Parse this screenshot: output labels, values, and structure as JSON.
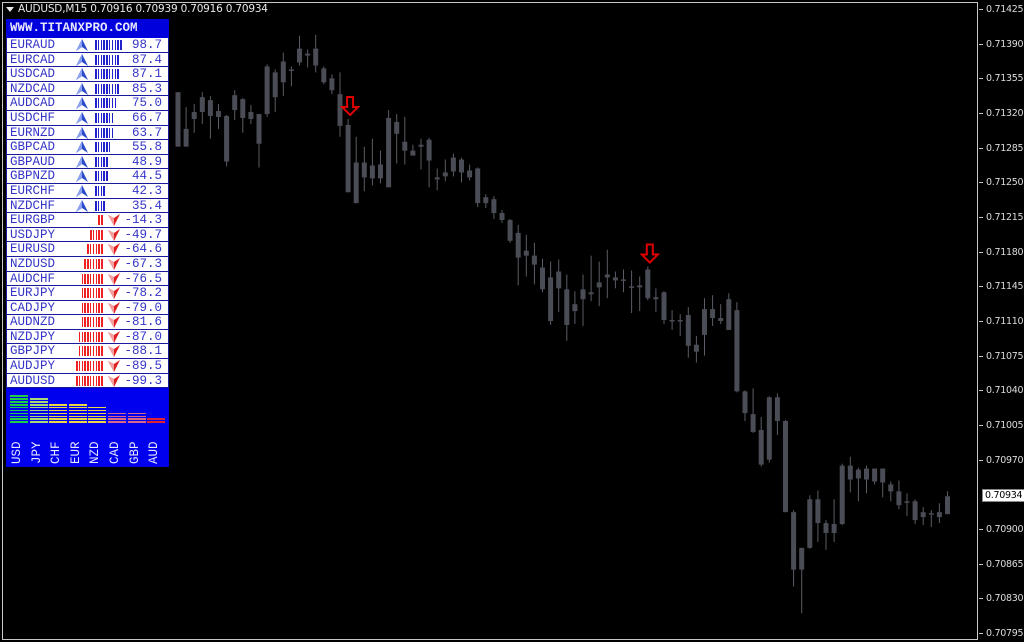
{
  "window": {
    "symbol": "AUDUSD",
    "timeframe": "M15",
    "title": "AUDUSD,M15  0.70916 0.70939 0.70916 0.70934",
    "ohlc": {
      "open": "0.70916",
      "high": "0.70939",
      "low": "0.70916",
      "close": "0.70934"
    }
  },
  "price_axis": {
    "ticks": [
      "0.71425",
      "0.71390",
      "0.71355",
      "0.71320",
      "0.71285",
      "0.71250",
      "0.71215",
      "0.71180",
      "0.71145",
      "0.71110",
      "0.71075",
      "0.71040",
      "0.71005",
      "0.70970",
      "0.70900",
      "0.70865",
      "0.70830",
      "0.70795"
    ],
    "current_price": "0.70934",
    "max": 0.71425,
    "min": 0.70795
  },
  "colors": {
    "candle": "#4a4d55",
    "candle_wick": "#5a5d65",
    "signal_arrow": "#e00000",
    "panel_blue": "#0000ee",
    "text_blue": "#3434c8",
    "bar_blue": "#2222cc",
    "bar_red": "#ee2222",
    "up_arrow": "#2a4ac8",
    "down_arrow": "#e02020"
  },
  "panel": {
    "header": "WWW.TITANXPRO.COM",
    "pairs": [
      {
        "pair": "EURAUD",
        "dir": "up",
        "bars": 10,
        "value": "98.7"
      },
      {
        "pair": "EURCAD",
        "dir": "up",
        "bars": 9,
        "value": "87.4"
      },
      {
        "pair": "USDCAD",
        "dir": "up",
        "bars": 9,
        "value": "87.1"
      },
      {
        "pair": "NZDCAD",
        "dir": "up",
        "bars": 9,
        "value": "85.3"
      },
      {
        "pair": "AUDCAD",
        "dir": "up",
        "bars": 8,
        "value": "75.0"
      },
      {
        "pair": "USDCHF",
        "dir": "up",
        "bars": 7,
        "value": "66.7"
      },
      {
        "pair": "EURNZD",
        "dir": "up",
        "bars": 7,
        "value": "63.7"
      },
      {
        "pair": "GBPCAD",
        "dir": "up",
        "bars": 6,
        "value": "55.8"
      },
      {
        "pair": "GBPAUD",
        "dir": "up",
        "bars": 5,
        "value": "48.9"
      },
      {
        "pair": "GBPNZD",
        "dir": "up",
        "bars": 5,
        "value": "44.5"
      },
      {
        "pair": "EURCHF",
        "dir": "up",
        "bars": 4,
        "value": "42.3"
      },
      {
        "pair": "NZDCHF",
        "dir": "up",
        "bars": 4,
        "value": "35.4"
      },
      {
        "pair": "EURGBP",
        "dir": "down",
        "bars": 2,
        "value": "-14.3"
      },
      {
        "pair": "USDJPY",
        "dir": "down",
        "bars": 5,
        "value": "-49.7"
      },
      {
        "pair": "EURUSD",
        "dir": "down",
        "bars": 6,
        "value": "-64.6"
      },
      {
        "pair": "NZDUSD",
        "dir": "down",
        "bars": 7,
        "value": "-67.3"
      },
      {
        "pair": "AUDCHF",
        "dir": "down",
        "bars": 8,
        "value": "-76.5"
      },
      {
        "pair": "EURJPY",
        "dir": "down",
        "bars": 8,
        "value": "-78.2"
      },
      {
        "pair": "CADJPY",
        "dir": "down",
        "bars": 8,
        "value": "-79.0"
      },
      {
        "pair": "AUDNZD",
        "dir": "down",
        "bars": 8,
        "value": "-81.6"
      },
      {
        "pair": "NZDJPY",
        "dir": "down",
        "bars": 9,
        "value": "-87.0"
      },
      {
        "pair": "GBPJPY",
        "dir": "down",
        "bars": 9,
        "value": "-88.1"
      },
      {
        "pair": "AUDJPY",
        "dir": "down",
        "bars": 10,
        "value": "-89.5"
      },
      {
        "pair": "AUDUSD",
        "dir": "down",
        "bars": 10,
        "value": "-99.3"
      }
    ],
    "currencies": [
      {
        "name": "USD",
        "level": 10,
        "color": "#22cc44"
      },
      {
        "name": "JPY",
        "level": 9,
        "color": "#a8d878"
      },
      {
        "name": "CHF",
        "level": 7,
        "color": "#e8d848"
      },
      {
        "name": "EUR",
        "level": 7,
        "color": "#e8d848"
      },
      {
        "name": "NZD",
        "level": 6,
        "color": "#e8d848"
      },
      {
        "name": "CAD",
        "level": 4,
        "color": "#d86888"
      },
      {
        "name": "GBP",
        "level": 4,
        "color": "#d86888"
      },
      {
        "name": "AUD",
        "level": 2,
        "color": "#dd2233"
      }
    ]
  },
  "chart_data": {
    "type": "candlestick",
    "symbol": "AUDUSD",
    "timeframe": "M15",
    "ylim": [
      0.70795,
      0.71425
    ],
    "candles": [
      {
        "o": 0.71342,
        "h": 0.71342,
        "l": 0.71287,
        "c": 0.71287
      },
      {
        "o": 0.71305,
        "h": 0.71327,
        "l": 0.71289,
        "c": 0.71287
      },
      {
        "o": 0.71315,
        "h": 0.7133,
        "l": 0.71301,
        "c": 0.71322
      },
      {
        "o": 0.71337,
        "h": 0.71342,
        "l": 0.7131,
        "c": 0.71322
      },
      {
        "o": 0.71334,
        "h": 0.71338,
        "l": 0.71295,
        "c": 0.71318
      },
      {
        "o": 0.71323,
        "h": 0.7133,
        "l": 0.71305,
        "c": 0.71317
      },
      {
        "o": 0.71318,
        "h": 0.71319,
        "l": 0.71267,
        "c": 0.71272
      },
      {
        "o": 0.71339,
        "h": 0.71344,
        "l": 0.71314,
        "c": 0.71324
      },
      {
        "o": 0.71335,
        "h": 0.71336,
        "l": 0.71301,
        "c": 0.71316
      },
      {
        "o": 0.71322,
        "h": 0.71329,
        "l": 0.7131,
        "c": 0.71315
      },
      {
        "o": 0.7129,
        "h": 0.7132,
        "l": 0.71266,
        "c": 0.7132
      },
      {
        "o": 0.7132,
        "h": 0.7137,
        "l": 0.71317,
        "c": 0.71368
      },
      {
        "o": 0.71337,
        "h": 0.71365,
        "l": 0.71322,
        "c": 0.71362
      },
      {
        "o": 0.71352,
        "h": 0.71382,
        "l": 0.71338,
        "c": 0.71373
      },
      {
        "o": 0.71365,
        "h": 0.71368,
        "l": 0.71348,
        "c": 0.71365
      },
      {
        "o": 0.71386,
        "h": 0.71399,
        "l": 0.71369,
        "c": 0.71372
      },
      {
        "o": 0.71381,
        "h": 0.71385,
        "l": 0.71367,
        "c": 0.71379
      },
      {
        "o": 0.71386,
        "h": 0.714,
        "l": 0.71362,
        "c": 0.71369
      },
      {
        "o": 0.71366,
        "h": 0.71368,
        "l": 0.7135,
        "c": 0.71352
      },
      {
        "o": 0.71356,
        "h": 0.7136,
        "l": 0.7134,
        "c": 0.71344
      },
      {
        "o": 0.7134,
        "h": 0.71362,
        "l": 0.71297,
        "c": 0.71308
      },
      {
        "o": 0.71309,
        "h": 0.71315,
        "l": 0.71241,
        "c": 0.71241
      },
      {
        "o": 0.71271,
        "h": 0.71297,
        "l": 0.7123,
        "c": 0.7123
      },
      {
        "o": 0.71271,
        "h": 0.71287,
        "l": 0.71242,
        "c": 0.71256
      },
      {
        "o": 0.71268,
        "h": 0.71295,
        "l": 0.71248,
        "c": 0.71255
      },
      {
        "o": 0.71269,
        "h": 0.71283,
        "l": 0.7125,
        "c": 0.71255
      },
      {
        "o": 0.71316,
        "h": 0.71324,
        "l": 0.71246,
        "c": 0.71246
      },
      {
        "o": 0.71312,
        "h": 0.7132,
        "l": 0.7127,
        "c": 0.713
      },
      {
        "o": 0.71292,
        "h": 0.71317,
        "l": 0.71269,
        "c": 0.71283
      },
      {
        "o": 0.71283,
        "h": 0.71289,
        "l": 0.71279,
        "c": 0.71278
      },
      {
        "o": 0.71289,
        "h": 0.71295,
        "l": 0.71264,
        "c": 0.71287
      },
      {
        "o": 0.71294,
        "h": 0.71296,
        "l": 0.71246,
        "c": 0.71273
      },
      {
        "o": 0.71256,
        "h": 0.71265,
        "l": 0.71243,
        "c": 0.71254
      },
      {
        "o": 0.71261,
        "h": 0.71274,
        "l": 0.71252,
        "c": 0.71257
      },
      {
        "o": 0.71276,
        "h": 0.7128,
        "l": 0.71257,
        "c": 0.71262
      },
      {
        "o": 0.71274,
        "h": 0.71276,
        "l": 0.71251,
        "c": 0.71261
      },
      {
        "o": 0.71263,
        "h": 0.71269,
        "l": 0.71253,
        "c": 0.71256
      },
      {
        "o": 0.71265,
        "h": 0.71266,
        "l": 0.71226,
        "c": 0.7123
      },
      {
        "o": 0.71236,
        "h": 0.71239,
        "l": 0.71225,
        "c": 0.7123
      },
      {
        "o": 0.71234,
        "h": 0.71237,
        "l": 0.71214,
        "c": 0.7122
      },
      {
        "o": 0.7122,
        "h": 0.71223,
        "l": 0.7121,
        "c": 0.71213
      },
      {
        "o": 0.71213,
        "h": 0.71214,
        "l": 0.7119,
        "c": 0.71192
      },
      {
        "o": 0.712,
        "h": 0.71208,
        "l": 0.71147,
        "c": 0.71175
      },
      {
        "o": 0.71182,
        "h": 0.71198,
        "l": 0.71156,
        "c": 0.71177
      },
      {
        "o": 0.71177,
        "h": 0.7119,
        "l": 0.71148,
        "c": 0.71168
      },
      {
        "o": 0.71165,
        "h": 0.71174,
        "l": 0.7114,
        "c": 0.71143
      },
      {
        "o": 0.71155,
        "h": 0.71171,
        "l": 0.71107,
        "c": 0.71111
      },
      {
        "o": 0.71161,
        "h": 0.71173,
        "l": 0.7112,
        "c": 0.71144
      },
      {
        "o": 0.71143,
        "h": 0.71158,
        "l": 0.71091,
        "c": 0.71107
      },
      {
        "o": 0.71128,
        "h": 0.71141,
        "l": 0.71108,
        "c": 0.71121
      },
      {
        "o": 0.71143,
        "h": 0.71158,
        "l": 0.71106,
        "c": 0.71133
      },
      {
        "o": 0.71138,
        "h": 0.71177,
        "l": 0.71131,
        "c": 0.7114
      },
      {
        "o": 0.7115,
        "h": 0.71171,
        "l": 0.71126,
        "c": 0.71145
      },
      {
        "o": 0.71158,
        "h": 0.71183,
        "l": 0.71134,
        "c": 0.71155
      },
      {
        "o": 0.71155,
        "h": 0.71161,
        "l": 0.71144,
        "c": 0.71152
      },
      {
        "o": 0.71153,
        "h": 0.71163,
        "l": 0.7114,
        "c": 0.71152
      },
      {
        "o": 0.71145,
        "h": 0.71162,
        "l": 0.71119,
        "c": 0.71146
      },
      {
        "o": 0.71147,
        "h": 0.71156,
        "l": 0.71121,
        "c": 0.71145
      },
      {
        "o": 0.71163,
        "h": 0.71166,
        "l": 0.71132,
        "c": 0.71134
      },
      {
        "o": 0.71135,
        "h": 0.71144,
        "l": 0.7112,
        "c": 0.71133
      },
      {
        "o": 0.7114,
        "h": 0.71141,
        "l": 0.71108,
        "c": 0.71112
      },
      {
        "o": 0.71112,
        "h": 0.71122,
        "l": 0.71102,
        "c": 0.71111
      },
      {
        "o": 0.71112,
        "h": 0.71118,
        "l": 0.71096,
        "c": 0.71111
      },
      {
        "o": 0.71117,
        "h": 0.71125,
        "l": 0.71074,
        "c": 0.71086
      },
      {
        "o": 0.71087,
        "h": 0.71096,
        "l": 0.71069,
        "c": 0.7108
      },
      {
        "o": 0.71097,
        "h": 0.71134,
        "l": 0.71076,
        "c": 0.71123
      },
      {
        "o": 0.71123,
        "h": 0.71137,
        "l": 0.71106,
        "c": 0.71114
      },
      {
        "o": 0.71114,
        "h": 0.71128,
        "l": 0.71108,
        "c": 0.71111
      },
      {
        "o": 0.71133,
        "h": 0.71139,
        "l": 0.71105,
        "c": 0.71102
      },
      {
        "o": 0.71122,
        "h": 0.7113,
        "l": 0.71039,
        "c": 0.7104
      },
      {
        "o": 0.7104,
        "h": 0.71041,
        "l": 0.7101,
        "c": 0.71018
      },
      {
        "o": 0.71017,
        "h": 0.71043,
        "l": 0.70998,
        "c": 0.70999
      },
      {
        "o": 0.71001,
        "h": 0.71014,
        "l": 0.70964,
        "c": 0.70966
      },
      {
        "o": 0.71034,
        "h": 0.71035,
        "l": 0.70968,
        "c": 0.70971
      },
      {
        "o": 0.71034,
        "h": 0.71038,
        "l": 0.70996,
        "c": 0.7101
      },
      {
        "o": 0.7101,
        "h": 0.71011,
        "l": 0.70918,
        "c": 0.70918
      },
      {
        "o": 0.70918,
        "h": 0.7092,
        "l": 0.70843,
        "c": 0.7086
      },
      {
        "o": 0.7086,
        "h": 0.70864,
        "l": 0.70816,
        "c": 0.70882
      },
      {
        "o": 0.70882,
        "h": 0.70935,
        "l": 0.70881,
        "c": 0.70931
      },
      {
        "o": 0.70931,
        "h": 0.7094,
        "l": 0.70888,
        "c": 0.70907
      },
      {
        "o": 0.70907,
        "h": 0.7091,
        "l": 0.7088,
        "c": 0.70897
      },
      {
        "o": 0.70897,
        "h": 0.70931,
        "l": 0.70888,
        "c": 0.70906
      },
      {
        "o": 0.70906,
        "h": 0.70967,
        "l": 0.70905,
        "c": 0.70965
      },
      {
        "o": 0.70965,
        "h": 0.70974,
        "l": 0.70938,
        "c": 0.70951
      },
      {
        "o": 0.70961,
        "h": 0.70963,
        "l": 0.70929,
        "c": 0.70952
      },
      {
        "o": 0.70951,
        "h": 0.70965,
        "l": 0.70937,
        "c": 0.70962
      },
      {
        "o": 0.70962,
        "h": 0.7096,
        "l": 0.70946,
        "c": 0.70949
      },
      {
        "o": 0.70962,
        "h": 0.70962,
        "l": 0.70933,
        "c": 0.70948
      },
      {
        "o": 0.70946,
        "h": 0.70949,
        "l": 0.70929,
        "c": 0.70939
      },
      {
        "o": 0.70939,
        "h": 0.7095,
        "l": 0.70921,
        "c": 0.70925
      },
      {
        "o": 0.70929,
        "h": 0.70937,
        "l": 0.70914,
        "c": 0.70928
      },
      {
        "o": 0.70929,
        "h": 0.70931,
        "l": 0.70906,
        "c": 0.7091
      },
      {
        "o": 0.70913,
        "h": 0.70923,
        "l": 0.70905,
        "c": 0.70918
      },
      {
        "o": 0.70916,
        "h": 0.7092,
        "l": 0.70903,
        "c": 0.70917
      },
      {
        "o": 0.70913,
        "h": 0.70927,
        "l": 0.70907,
        "c": 0.70918
      },
      {
        "o": 0.70916,
        "h": 0.70939,
        "l": 0.70916,
        "c": 0.70934
      }
    ],
    "signals": [
      {
        "type": "sell-arrow",
        "candle_index": 21
      },
      {
        "type": "sell-arrow",
        "candle_index": 58
      }
    ]
  }
}
